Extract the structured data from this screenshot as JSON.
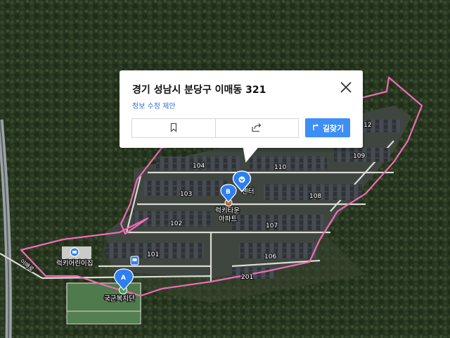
{
  "popup": {
    "title": "경기 성남시 분당구 이매동 321",
    "edit_link": "정보 수정 제안",
    "bookmark_icon": "bookmark-icon",
    "share_icon": "share-icon",
    "route_label": "길찾기",
    "close_icon": "close-icon"
  },
  "map": {
    "buildings": [
      "104",
      "110",
      "109",
      "103",
      "108",
      "102",
      "107",
      "101",
      "106",
      "201"
    ],
    "partial_building": "12",
    "poi": {
      "apartment_line1": "럭키타운",
      "apartment_line2": "아파트",
      "center_partial": "센터",
      "daycare": "럭키어린이집",
      "park": "국군복지단",
      "road": "이매로"
    },
    "markers": {
      "a_label": "A",
      "b_label": "B"
    },
    "colors": {
      "boundary": "#f06bb5",
      "marker_blue": "#2d7ff2",
      "road": "#e8e8e0"
    }
  }
}
